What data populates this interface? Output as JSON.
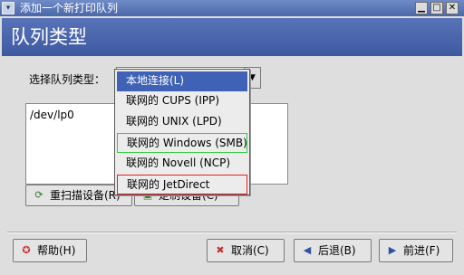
{
  "window": {
    "title": "添加一个新打印队列",
    "icon": "printer-window-icon",
    "controls": [
      "minimize",
      "maximize",
      "close"
    ]
  },
  "header": {
    "title": "队列类型"
  },
  "queue_type": {
    "label": "选择队列类型：",
    "selected_value": "本地连接(L)",
    "options": [
      "本地连接(L)",
      "联网的 CUPS (IPP)",
      "联网的 UNIX (LPD)",
      "联网的 Windows (SMB)",
      "联网的 Novell (NCP)",
      "联网的 JetDirect"
    ]
  },
  "devices": {
    "items": [
      "/dev/lp0"
    ]
  },
  "buttons": {
    "rescan_devices": "重扫描设备(R)",
    "custom_device": "定制设备(C)",
    "help": "帮助(H)",
    "cancel": "取消(C)",
    "back": "后退(B)",
    "forward": "前进(F)"
  },
  "icons": {
    "rescan": "refresh-icon",
    "custom": "device-icon",
    "help": "lifebuoy-icon",
    "cancel": "close-icon",
    "back": "arrow-left-icon",
    "forward": "arrow-right-icon"
  },
  "colors": {
    "titlebar": "#4a67a8",
    "header": "#3e59a0",
    "selection": "#3f62b6",
    "highlight_green": "#2ecc40",
    "highlight_red": "#e02020"
  }
}
